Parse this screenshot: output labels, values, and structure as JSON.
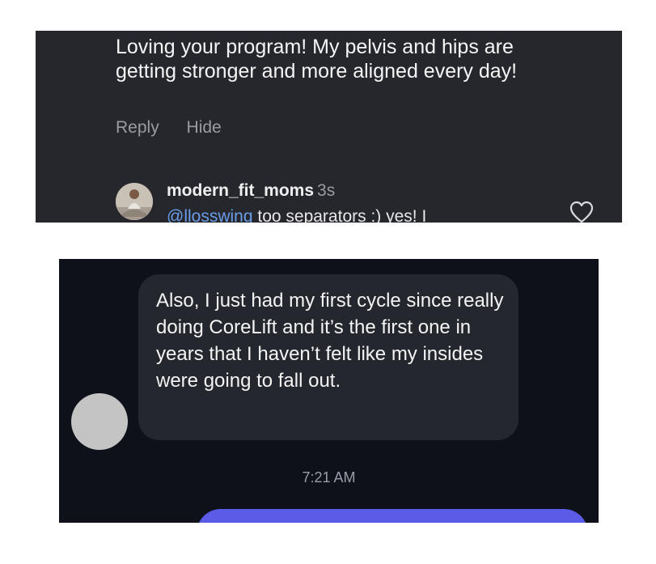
{
  "comment": {
    "text": "Loving your program! My pelvis and hips are getting stronger and more aligned every day!",
    "actions": {
      "reply": "Reply",
      "hide": "Hide"
    }
  },
  "reply": {
    "username": "modern_fit_moms",
    "time": "3s",
    "mention": "@llosswing",
    "text": " too separators :) yes! I"
  },
  "dm": {
    "message": "Also, I just had my first cycle since really doing CoreLift and it’s the first one in years that I haven’t felt like my insides were going to fall out.",
    "timestamp": "7:21 AM"
  },
  "colors": {
    "top_panel_bg": "#26272d",
    "bottom_panel_bg": "#0e111a",
    "bubble_bg": "#25272e",
    "outgoing_bubble": "#5a5be6",
    "mention": "#6a9de8"
  },
  "icons": [
    "avatar-photo",
    "heart-icon",
    "avatar-placeholder"
  ]
}
